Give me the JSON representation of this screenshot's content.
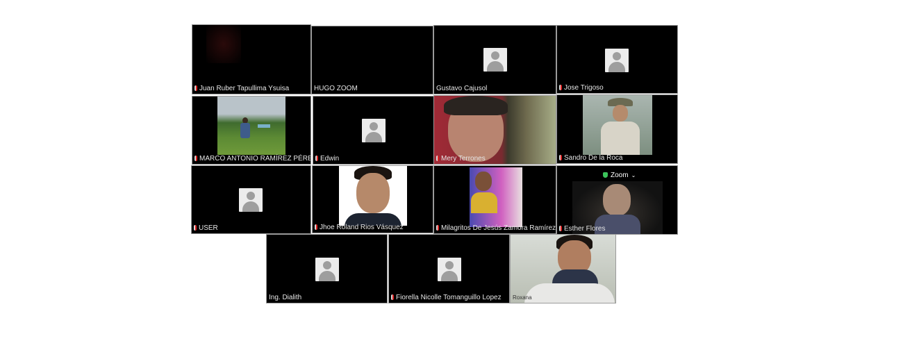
{
  "meeting": {
    "app_label": "Zoom",
    "secure_icon": "shield-check-icon",
    "participants": [
      {
        "name": "Juan Ruber Tapullima Ysuisa",
        "muted": true,
        "video": "dark"
      },
      {
        "name": "HUGO ZOOM",
        "muted": false,
        "video": "dark"
      },
      {
        "name": "Gustavo Cajusol",
        "muted": false,
        "video": "avatar"
      },
      {
        "name": "Jose Trigoso",
        "muted": true,
        "video": "avatar"
      },
      {
        "name": "MARCO ANTONIO RAMÍREZ PÉREZ",
        "muted": true,
        "video": "photo"
      },
      {
        "name": "Edwin",
        "muted": true,
        "video": "avatar"
      },
      {
        "name": "Mery Terrones",
        "muted": true,
        "video": "camera"
      },
      {
        "name": "Sandro De la Roca",
        "muted": true,
        "video": "photo"
      },
      {
        "name": "USER",
        "muted": true,
        "video": "avatar"
      },
      {
        "name": "Jhoe Roland Rios Vásquez",
        "muted": true,
        "video": "photo"
      },
      {
        "name": "Milagritos De Jesús Zamora Ramírez",
        "muted": true,
        "video": "camera"
      },
      {
        "name": "Esther Flores",
        "muted": true,
        "video": "camera"
      },
      {
        "name": "Ing. Dialith",
        "muted": false,
        "video": "avatar"
      },
      {
        "name": "Fiorella Nicolle Tomanguillo Lopez",
        "muted": true,
        "video": "avatar"
      },
      {
        "name": "Roxana",
        "muted": false,
        "video": "camera"
      }
    ]
  }
}
